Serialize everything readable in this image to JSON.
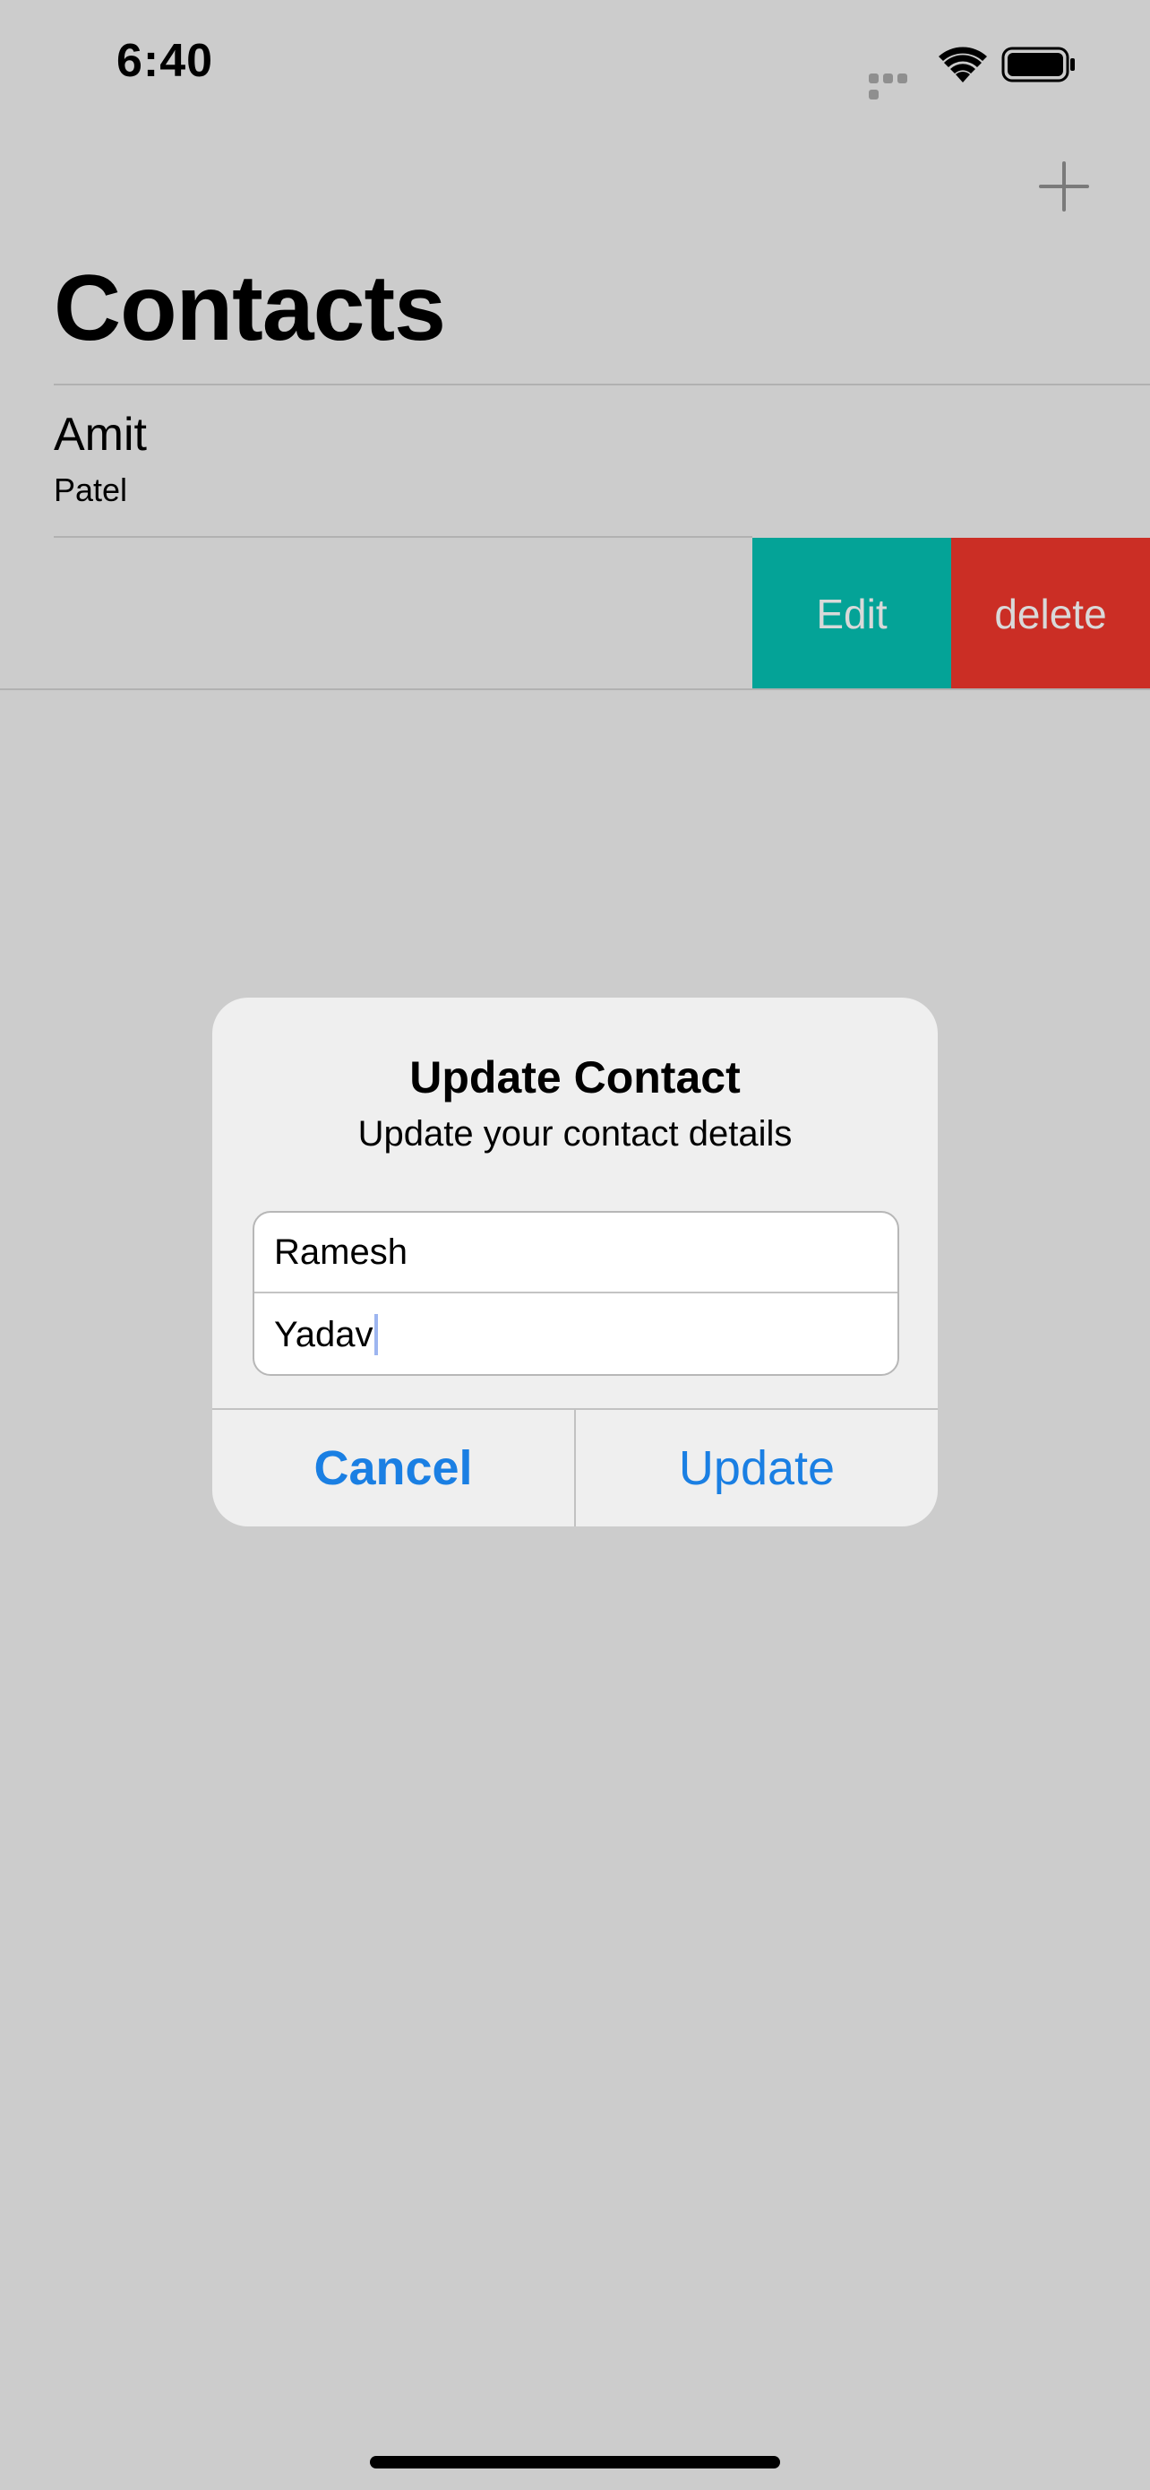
{
  "status_bar": {
    "time": "6:40",
    "signal_icon": "signal-dots-icon",
    "wifi_icon": "wifi-icon",
    "battery_icon": "battery-full-icon"
  },
  "nav": {
    "add_icon": "plus-icon",
    "title": "Contacts"
  },
  "contacts": [
    {
      "first_name": "Amit",
      "last_name": "Patel"
    }
  ],
  "row_actions": {
    "edit_label": "Edit",
    "delete_label": "delete",
    "edit_color": "#04a397",
    "delete_color": "#cb2e25"
  },
  "alert": {
    "title": "Update Contact",
    "message": "Update your contact details",
    "first_field_value": "Ramesh",
    "second_field_value": "Yadav",
    "cancel_label": "Cancel",
    "update_label": "Update",
    "button_color": "#1a7fe3"
  },
  "colors": {
    "background_dimmed": "#cccccc",
    "alert_background": "#efefef"
  }
}
